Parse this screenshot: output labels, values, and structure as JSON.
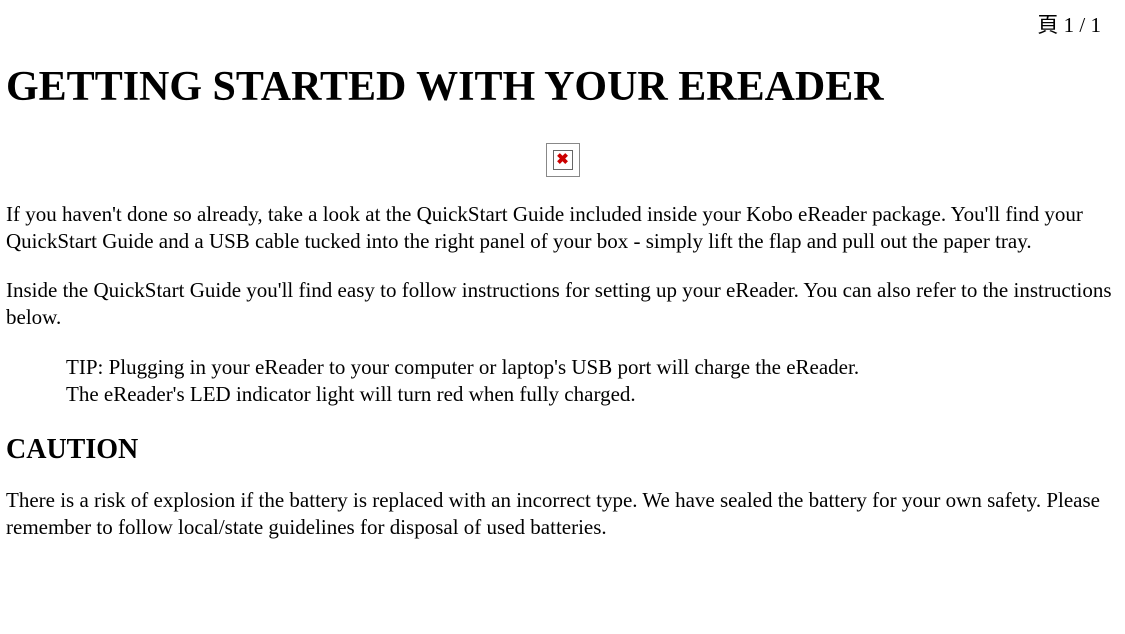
{
  "page_indicator": "頁 1 / 1",
  "title": "GETTING STARTED WITH YOUR EREADER",
  "broken_image_mark": "✖",
  "para1": "If you haven't done so already, take a look at the QuickStart Guide included inside your Kobo eReader package. You'll find your QuickStart Guide and a USB cable tucked into the right panel of your box - simply lift the flap and pull out the paper tray.",
  "para2": "Inside the QuickStart Guide you'll find easy to follow instructions for setting up your eReader. You can also refer to the instructions below.",
  "tip_line1": "TIP: Plugging in your eReader to your computer or laptop's USB port will charge the eReader.",
  "tip_line2": "The eReader's LED indicator light will turn red when fully charged.",
  "caution_heading": "CAUTION",
  "caution_para": "There is a risk of explosion if the battery is replaced with an incorrect type. We have sealed the battery for your own safety. Please remember to follow local/state guidelines for disposal of used batteries."
}
